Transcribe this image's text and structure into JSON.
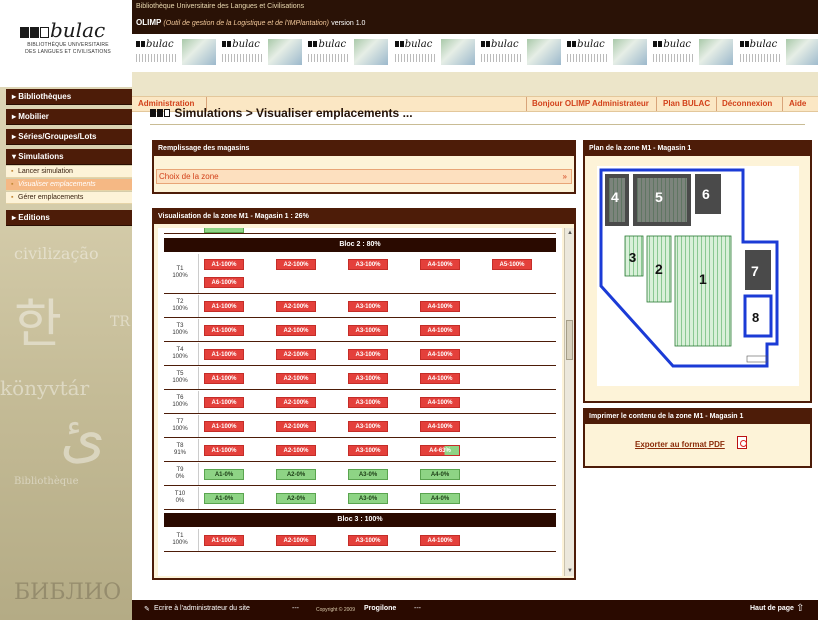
{
  "header": {
    "institution": "Bibliothèque Universitaire des Langues et Civilisations",
    "app_name": "OLIMP",
    "app_desc": "(Outil de gestion de la Logistique et de l'IMPlantation)",
    "version": "version 1.0",
    "logo_text": "bulac",
    "logo_sub_1": "BIBLIOTHÈQUE UNIVERSITAIRE",
    "logo_sub_2": "DES LANGUES ET CIVILISATIONS"
  },
  "menu": {
    "admin": "Administration",
    "hello": "Bonjour OLIMP Administrateur",
    "plan": "Plan BULAC",
    "logout": "Déconnexion",
    "help": "Aide"
  },
  "sidebar": {
    "items": [
      "Bibliothèques",
      "Mobilier",
      "Séries/Groupes/Lots",
      "Simulations",
      "Editions"
    ],
    "sub": [
      "Lancer simulation",
      "Visualiser emplacements",
      "Gérer emplacements"
    ],
    "deco": [
      "civilização",
      "한",
      "TR",
      "könyvtár",
      "ئ",
      "Bibliothèque",
      "БИБЛИО"
    ]
  },
  "page": {
    "title": "Simulations > Visualiser emplacements",
    "ellipsis": "..."
  },
  "remplissage": {
    "title": "Remplissage des magasins",
    "select": "Choix de la zone"
  },
  "visu": {
    "title": "Visualisation de la zone M1 - Magasin 1 : 26%",
    "blocs": [
      {
        "label": "Bloc 2 : 80%",
        "rows": [
          {
            "t": "T1",
            "p": "100%",
            "cells": [
              "A1-100%",
              "A2-100%",
              "A3-100%",
              "A4-100%",
              "A5-100%",
              "A6-100%"
            ],
            "s": [
              "r",
              "r",
              "r",
              "r",
              "r",
              "r"
            ]
          },
          {
            "t": "T2",
            "p": "100%",
            "cells": [
              "A1-100%",
              "A2-100%",
              "A3-100%",
              "A4-100%"
            ],
            "s": [
              "r",
              "r",
              "r",
              "r"
            ]
          },
          {
            "t": "T3",
            "p": "100%",
            "cells": [
              "A1-100%",
              "A2-100%",
              "A3-100%",
              "A4-100%"
            ],
            "s": [
              "r",
              "r",
              "r",
              "r"
            ]
          },
          {
            "t": "T4",
            "p": "100%",
            "cells": [
              "A1-100%",
              "A2-100%",
              "A3-100%",
              "A4-100%"
            ],
            "s": [
              "r",
              "r",
              "r",
              "r"
            ]
          },
          {
            "t": "T5",
            "p": "100%",
            "cells": [
              "A1-100%",
              "A2-100%",
              "A3-100%",
              "A4-100%"
            ],
            "s": [
              "r",
              "r",
              "r",
              "r"
            ]
          },
          {
            "t": "T6",
            "p": "100%",
            "cells": [
              "A1-100%",
              "A2-100%",
              "A3-100%",
              "A4-100%"
            ],
            "s": [
              "r",
              "r",
              "r",
              "r"
            ]
          },
          {
            "t": "T7",
            "p": "100%",
            "cells": [
              "A1-100%",
              "A2-100%",
              "A3-100%",
              "A4-100%"
            ],
            "s": [
              "r",
              "r",
              "r",
              "r"
            ]
          },
          {
            "t": "T8",
            "p": "91%",
            "cells": [
              "A1-100%",
              "A2-100%",
              "A3-100%",
              "A4-63%"
            ],
            "s": [
              "r",
              "r",
              "r",
              "p"
            ]
          },
          {
            "t": "T9",
            "p": "0%",
            "cells": [
              "A1-0%",
              "A2-0%",
              "A3-0%",
              "A4-0%"
            ],
            "s": [
              "g",
              "g",
              "g",
              "g"
            ]
          },
          {
            "t": "T10",
            "p": "0%",
            "cells": [
              "A1-0%",
              "A2-0%",
              "A3-0%",
              "A4-0%"
            ],
            "s": [
              "g",
              "g",
              "g",
              "g"
            ]
          }
        ]
      },
      {
        "label": "Bloc 3 : 100%",
        "rows": [
          {
            "t": "T1",
            "p": "100%",
            "cells": [
              "A1-100%",
              "A2-100%",
              "A3-100%",
              "A4-100%"
            ],
            "s": [
              "r",
              "r",
              "r",
              "r"
            ]
          }
        ]
      }
    ]
  },
  "plan": {
    "title": "Plan de la zone M1 - Magasin 1",
    "zones": [
      "4",
      "5",
      "6",
      "3",
      "2",
      "1",
      "7",
      "8"
    ]
  },
  "print": {
    "title": "Imprimer le contenu de la zone M1 - Magasin 1",
    "export": "Exporter au format PDF"
  },
  "footer": {
    "write": "Ecrire à l'administrateur du site",
    "dots": "---",
    "copyright": "Copyright © 2009",
    "company": "Progilone",
    "top": "Haut de page"
  },
  "colors": {
    "full": "#e4403b",
    "empty": "#8ed485",
    "brown": "#4d1c08",
    "orange": "#d2411a"
  }
}
